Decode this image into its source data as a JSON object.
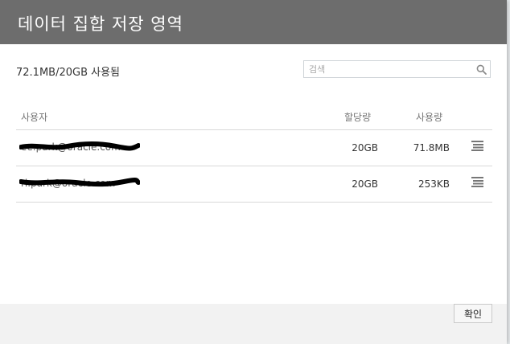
{
  "dialog": {
    "title": "데이터 집합 저장 영역",
    "usage_summary": "72.1MB/20GB 사용됨",
    "search": {
      "placeholder": "검색",
      "value": ""
    },
    "table": {
      "columns": {
        "user": "사용자",
        "quota": "할당량",
        "used": "사용량"
      },
      "rows": [
        {
          "user": "ee.park@oracle.com",
          "quota": "20GB",
          "used": "71.8MB"
        },
        {
          "user": "ri.park@oracle.com",
          "quota": "20GB",
          "used": "253KB"
        }
      ]
    },
    "ok_label": "확인"
  },
  "icons": {
    "search": "search-icon",
    "row_menu": "hamburger-menu-icon"
  },
  "colors": {
    "header_bg": "#6d6d6d",
    "header_text": "#ffffff",
    "redaction": "#000000"
  }
}
